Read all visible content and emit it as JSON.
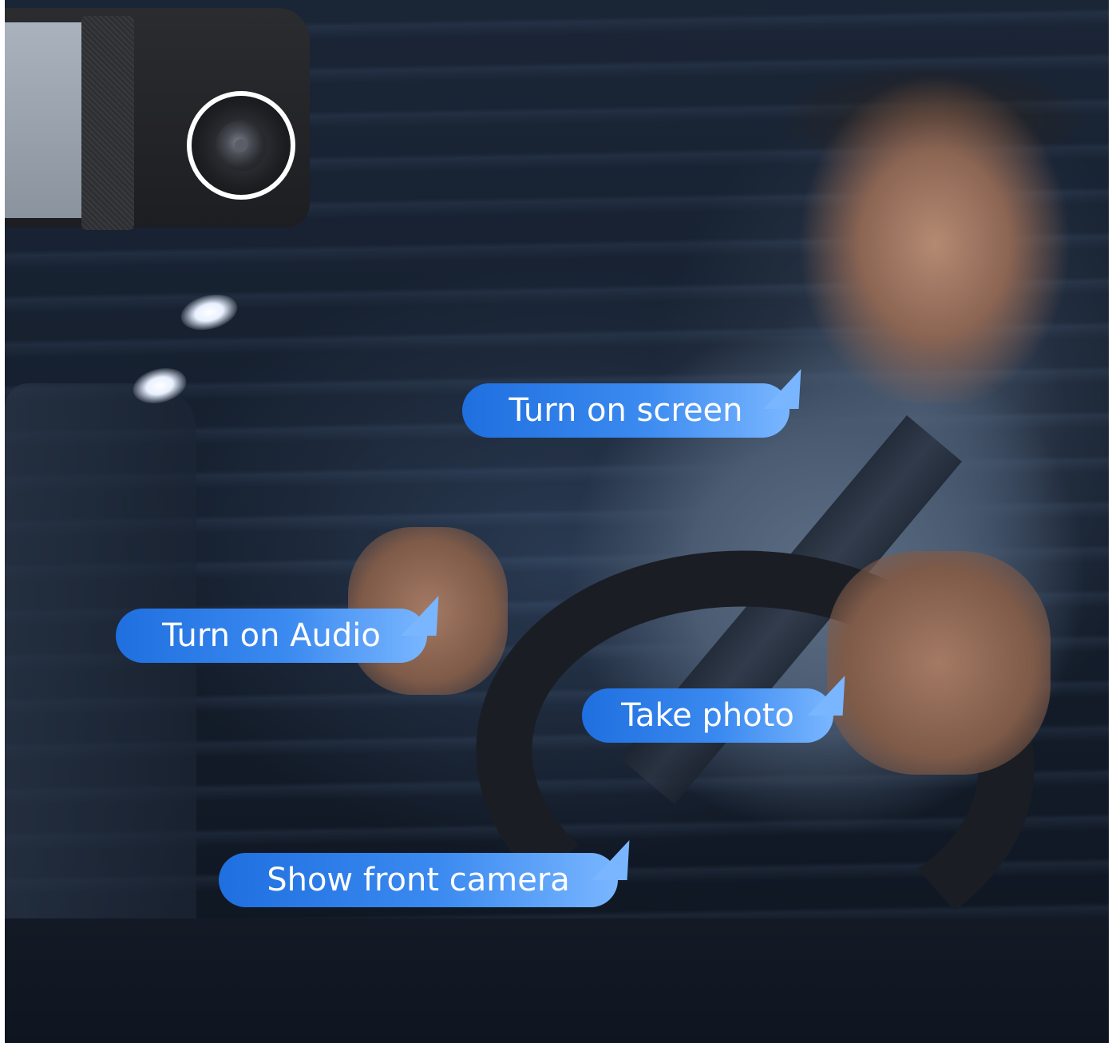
{
  "callouts": {
    "turn_on_screen": "Turn on screen",
    "turn_on_audio": "Turn on Audio",
    "take_photo": "Take photo",
    "show_front_camera": "Show front camera"
  },
  "colors": {
    "bubble_start": "#1f6fe0",
    "bubble_end": "#79b6ff",
    "background": "#16202f",
    "lens_ring": "#ffffff"
  },
  "icons": {
    "dash_cam": "dash-cam-lens-icon"
  }
}
